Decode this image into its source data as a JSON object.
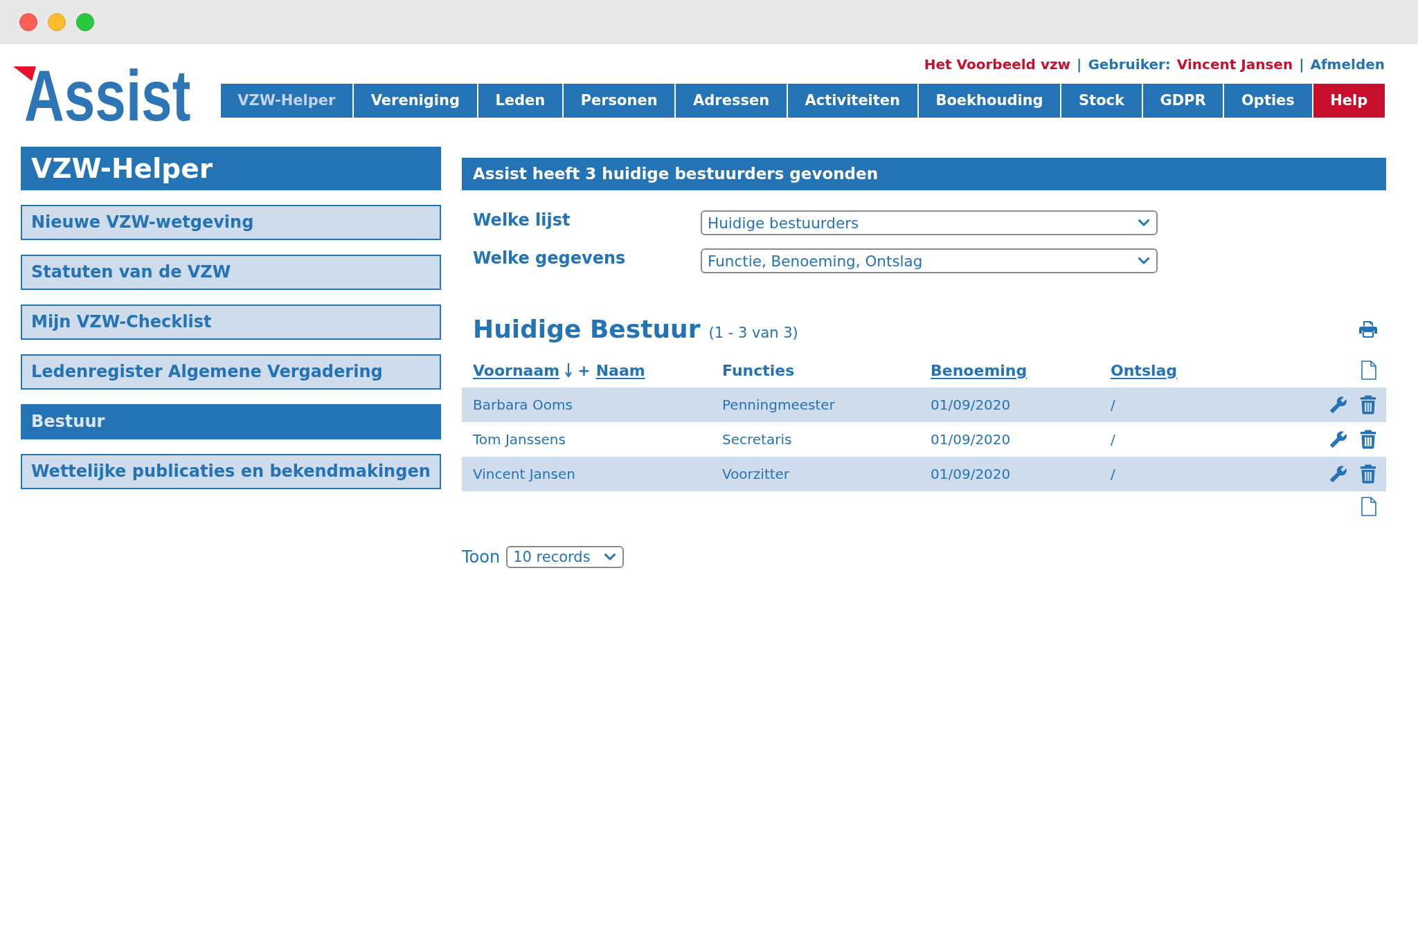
{
  "logo": {
    "text": "Assist"
  },
  "user_bar": [
    {
      "kind": "org",
      "text": "Het Voorbeeld vzw"
    },
    {
      "kind": "sep",
      "text": "|"
    },
    {
      "kind": "label",
      "text": "Gebruiker:"
    },
    {
      "kind": "name",
      "text": "Vincent Jansen"
    },
    {
      "kind": "sep",
      "text": "|"
    },
    {
      "kind": "link",
      "text": "Afmelden"
    }
  ],
  "nav_tabs": [
    {
      "label": "VZW-Helper",
      "selected": true,
      "kind": "menu"
    },
    {
      "label": "Vereniging",
      "selected": false,
      "kind": "menu"
    },
    {
      "label": "Leden",
      "selected": false,
      "kind": "menu"
    },
    {
      "label": "Personen",
      "selected": false,
      "kind": "menu"
    },
    {
      "label": "Adressen",
      "selected": false,
      "kind": "menu"
    },
    {
      "label": "Activiteiten",
      "selected": false,
      "kind": "menu"
    },
    {
      "label": "Boekhouding",
      "selected": false,
      "kind": "menu"
    },
    {
      "label": "Stock",
      "selected": false,
      "kind": "menu"
    },
    {
      "label": "GDPR",
      "selected": false,
      "kind": "menu"
    },
    {
      "label": "Opties",
      "selected": false,
      "kind": "menu"
    },
    {
      "label": "Help",
      "selected": false,
      "kind": "help"
    }
  ],
  "sidebar": {
    "title": "VZW-Helper",
    "items": [
      {
        "label": "Nieuwe VZW-wetgeving",
        "selected": false
      },
      {
        "label": "Statuten van de VZW",
        "selected": false
      },
      {
        "label": "Mijn VZW-Checklist",
        "selected": false
      },
      {
        "label": "Ledenregister Algemene Vergadering",
        "selected": false
      },
      {
        "label": "Bestuur",
        "selected": true
      },
      {
        "label": "Wettelijke publicaties en bekendmakingen",
        "selected": false
      }
    ]
  },
  "banner": {
    "text": "Assist heeft 3 huidige bestuurders gevonden"
  },
  "filters": [
    {
      "label": "Welke lijst",
      "value": "Huidige bestuurders"
    },
    {
      "label": "Welke gegevens",
      "value": "Functie, Benoeming, Ontslag"
    }
  ],
  "section": {
    "title": "Huidige Bestuur",
    "range": "(1 - 3 van 3)"
  },
  "table": {
    "columns": [
      {
        "labels": [
          "Voornaam",
          "Naam"
        ],
        "separator": "+",
        "sortable": true,
        "sorted": true
      },
      {
        "labels": [
          "Functies"
        ],
        "sortable": false,
        "sorted": false
      },
      {
        "labels": [
          "Benoeming"
        ],
        "sortable": true,
        "sorted": false
      },
      {
        "labels": [
          "Ontslag"
        ],
        "sortable": true,
        "sorted": false
      }
    ],
    "rows": [
      {
        "cells": [
          "Barbara Ooms",
          "Penningmeester",
          "01/09/2020",
          "/"
        ]
      },
      {
        "cells": [
          "Tom Janssens",
          "Secretaris",
          "01/09/2020",
          "/"
        ]
      },
      {
        "cells": [
          "Vincent Jansen",
          "Voorzitter",
          "01/09/2020",
          "/"
        ]
      }
    ]
  },
  "page_size": {
    "label": "Toon",
    "value": "10 records"
  }
}
